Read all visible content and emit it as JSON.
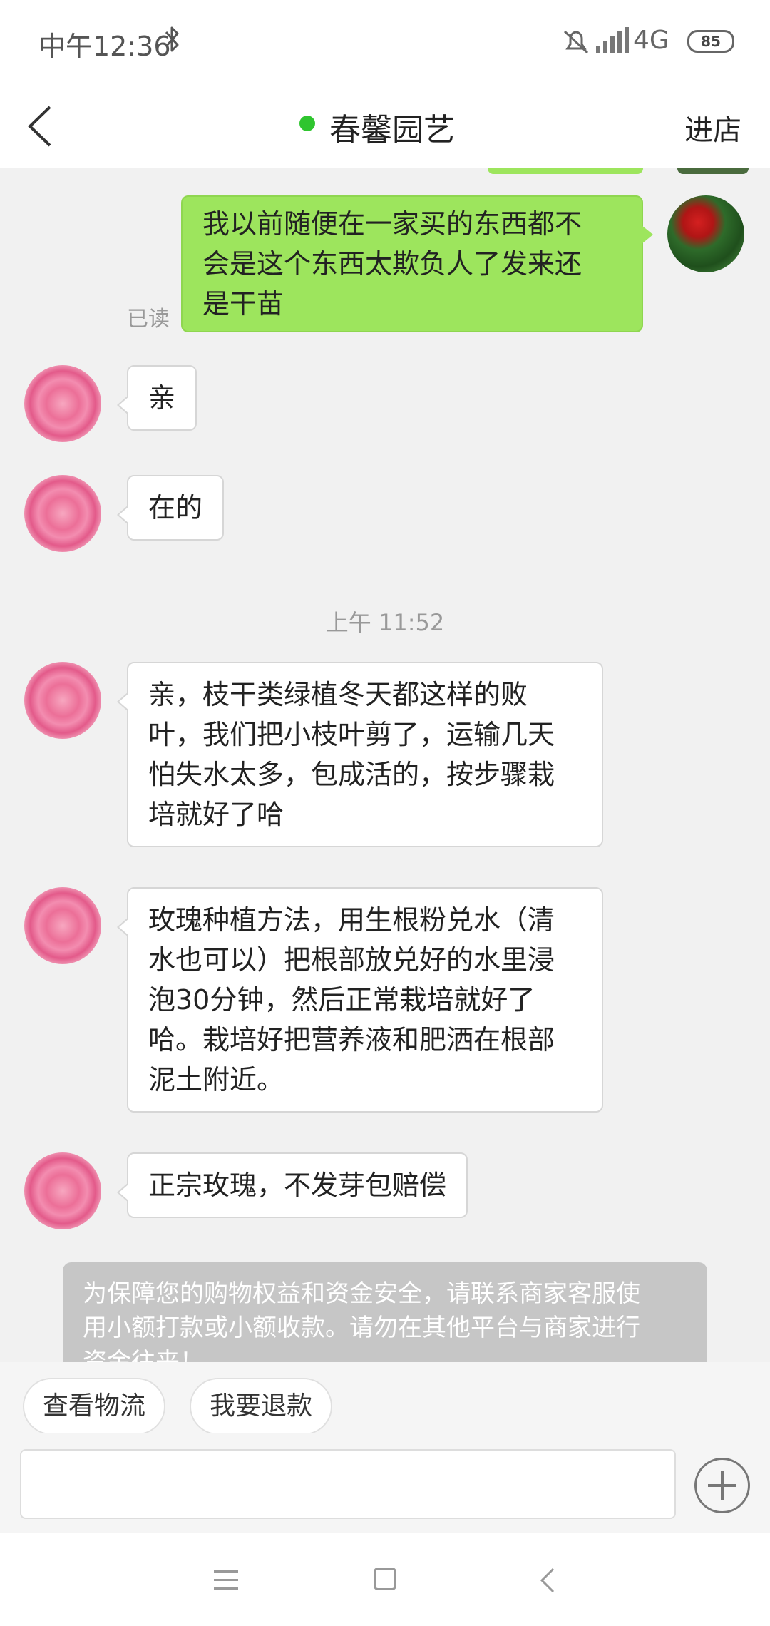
{
  "status_bar": {
    "time": "中午12:36",
    "network": "4G",
    "battery": "85"
  },
  "header": {
    "title": "春馨园艺",
    "enter_store": "进店"
  },
  "messages": [
    {
      "from": "me",
      "lines": [
        "我以前随便在一家买的东西都不",
        "会是这个东西太欺负人了发来还",
        "是干苗"
      ],
      "status": "已读"
    },
    {
      "from": "shop",
      "lines": [
        "亲"
      ]
    },
    {
      "from": "shop",
      "lines": [
        "在的"
      ]
    },
    {
      "from": "shop",
      "lines": [
        "亲，枝干类绿植冬天都这样的败",
        "叶，我们把小枝叶剪了，运输几天",
        "怕失水太多，包成活的，按步骤栽",
        "培就好了哈"
      ]
    },
    {
      "from": "shop",
      "lines": [
        "玫瑰种植方法，用生根粉兑水（清",
        "水也可以）把根部放兑好的水里浸",
        "泡30分钟，然后正常栽培就好了",
        "哈。栽培好把营养液和肥洒在根部",
        "泥土附近。"
      ]
    },
    {
      "from": "shop",
      "lines": [
        "正宗玫瑰，不发芽包赔偿"
      ]
    }
  ],
  "time_divider": "上午 11:52",
  "notice": {
    "lines": [
      "为保障您的购物权益和资金安全，请联系商家客服使",
      "用小额打款或小额收款。请勿在其他平台与商家进行",
      "资金往来！"
    ]
  },
  "quick_actions": [
    "查看物流",
    "我要退款"
  ],
  "input": {
    "placeholder": ""
  }
}
